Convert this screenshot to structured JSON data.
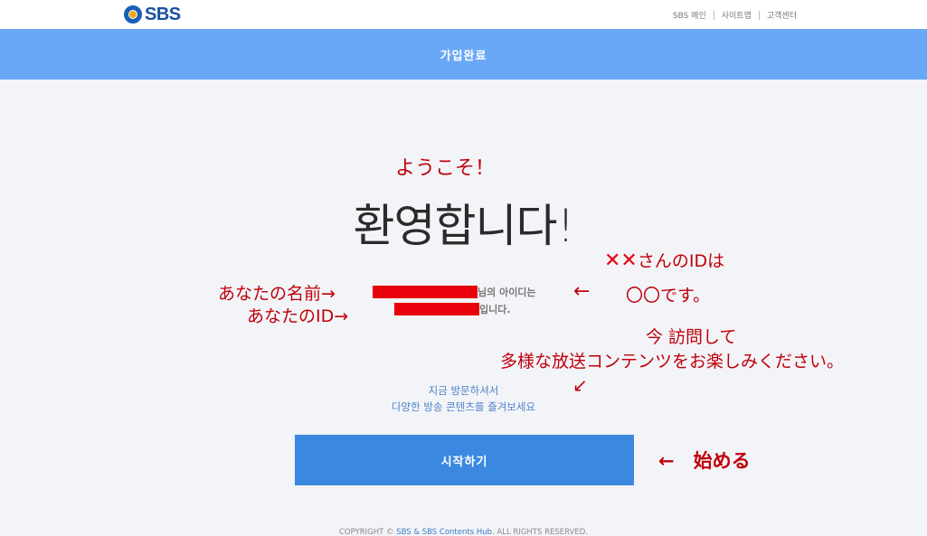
{
  "header": {
    "logo_text": "SBS",
    "nav": [
      {
        "label": "SBS 메인"
      },
      {
        "label": "사이트맵"
      },
      {
        "label": "고객센터"
      }
    ]
  },
  "band": {
    "title": "가입완료"
  },
  "main": {
    "welcome": "환영합니다!",
    "name_suffix": "님의 아이디는",
    "id_suffix": "입니다.",
    "visit_line1": "지금 방문하셔서",
    "visit_line2": "다양한 방송 콘텐츠를 즐겨보세요",
    "start_button": "시작하기"
  },
  "footer": {
    "prefix": "COPYRIGHT © ",
    "link": "SBS & SBS Contents Hub",
    "suffix": ". ALL RIGHTS RESERVED."
  },
  "annotations": {
    "welcome": "ようこそ！",
    "name_label": "あなたの名前→",
    "id_label": "あなたのID→",
    "arrow_left": "←",
    "xx_marks": "✕✕",
    "id_explain_1": "さんのIDは",
    "id_explain_2": "〇〇です。",
    "visit_1": "今 訪問して",
    "visit_2": "多様な放送コンテンツをお楽しみください。",
    "diag_arrow": "↙",
    "start": "←　始める"
  },
  "colors": {
    "band": "#68a8f6",
    "button": "#3b88e0",
    "annotation": "#c0000a",
    "redaction": "#e8000b"
  }
}
